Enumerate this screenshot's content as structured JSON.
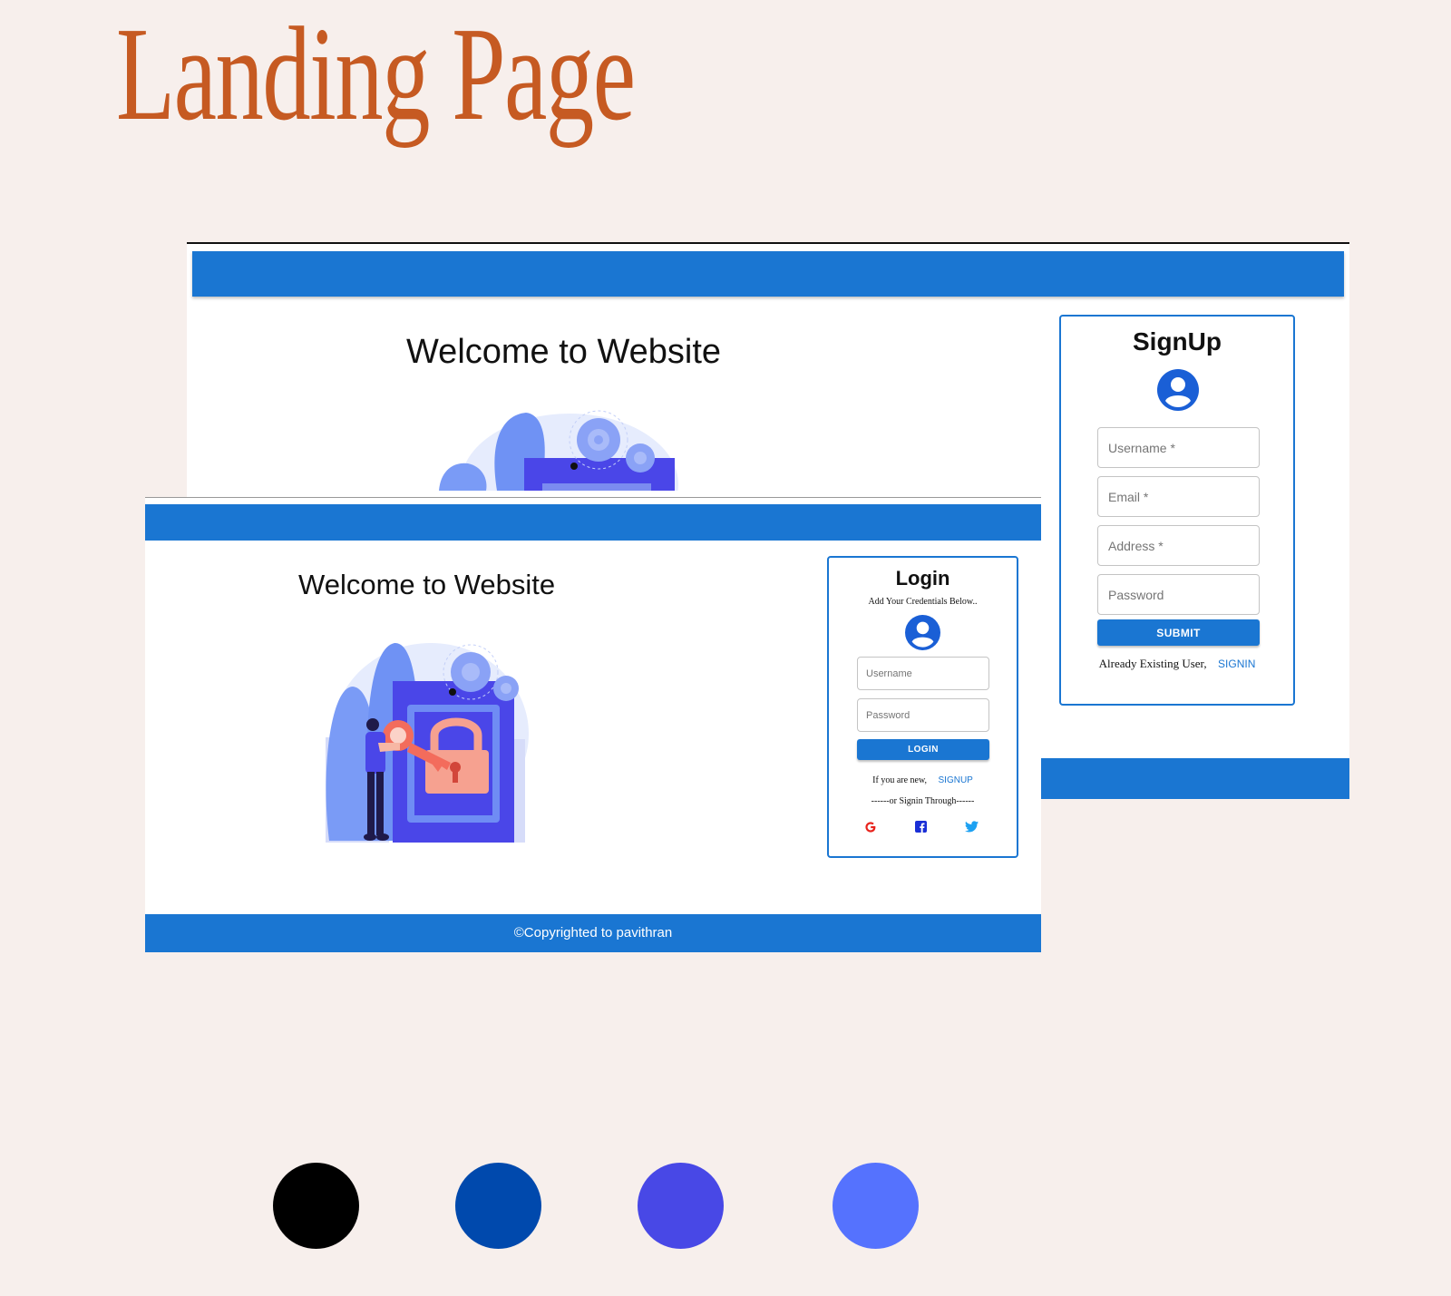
{
  "heading": "Landing Page",
  "signup_window": {
    "welcome": "Welcome to Website",
    "card": {
      "title": "SignUp",
      "fields": [
        {
          "placeholder": "Username *"
        },
        {
          "placeholder": "Email *"
        },
        {
          "placeholder": "Address *"
        },
        {
          "placeholder": "Password"
        }
      ],
      "submit_label": "SUBMIT",
      "existing_text": "Already Existing User,",
      "signin_link": "SIGNIN"
    }
  },
  "login_window": {
    "welcome": "Welcome to Website",
    "card": {
      "title": "Login",
      "subtitle": "Add Your Credentials Below..",
      "username_placeholder": "Username",
      "password_placeholder": "Password",
      "login_label": "LOGIN",
      "new_text": "If you are new,",
      "signup_link": "SIGNUP",
      "social_divider": "------or Signin Through------",
      "social_icons": [
        "google-icon",
        "facebook-icon",
        "twitter-icon"
      ]
    },
    "footer": "©Copyrighted to pavithran"
  },
  "palette": [
    "#000000",
    "#0049ad",
    "#4848e6",
    "#5572fe"
  ],
  "colors": {
    "accent": "#1a76d2",
    "title": "#c65a22",
    "background": "#f7efec"
  }
}
